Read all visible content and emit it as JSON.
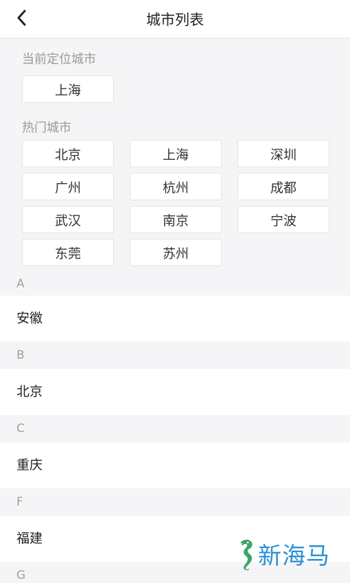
{
  "header": {
    "title": "城市列表",
    "back_icon": "chevron-left-icon"
  },
  "current_location": {
    "label": "当前定位城市",
    "city": "上海"
  },
  "hot_cities": {
    "label": "热门城市",
    "items": [
      "北京",
      "上海",
      "深圳",
      "广州",
      "杭州",
      "成都",
      "武汉",
      "南京",
      "宁波",
      "东莞",
      "苏州"
    ]
  },
  "index_groups": [
    {
      "letter": "A",
      "items": [
        "安徽"
      ]
    },
    {
      "letter": "B",
      "items": [
        "北京"
      ]
    },
    {
      "letter": "C",
      "items": [
        "重庆"
      ]
    },
    {
      "letter": "F",
      "items": [
        "福建"
      ]
    },
    {
      "letter": "G",
      "items": []
    }
  ],
  "watermark": {
    "text": "新海马",
    "icon": "seahorse-logo",
    "colors": {
      "text": "#2a8fd6",
      "logo": "#3aa66a"
    }
  }
}
